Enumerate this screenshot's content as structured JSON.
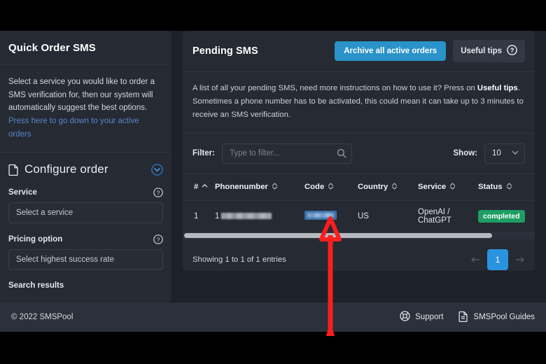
{
  "sidebar": {
    "title": "Quick Order SMS",
    "intro_text": "Select a service you would like to order a SMS verification for, then our system will automatically suggest the best options.",
    "intro_link": "Press here to go down to your active orders",
    "configure": {
      "title": "Configure order",
      "collapse_icon": "chevron-down-circle-icon",
      "doc_icon": "document-icon",
      "service_label": "Service",
      "service_help_icon": "question-circle-icon",
      "service_value": "Select a service",
      "pricing_label": "Pricing option",
      "pricing_help_icon": "question-circle-icon",
      "pricing_value": "Select highest success rate",
      "search_results_label": "Search results"
    }
  },
  "main": {
    "title": "Pending SMS",
    "archive_button": "Archive all active orders",
    "tips_button": "Useful tips",
    "tips_icon": "question-circle-icon",
    "description_part1": "A list of all your pending SMS, need more instructions on how to use it? Press on ",
    "description_bold": "Useful tips",
    "description_part2": ". Sometimes a phone number has to be activated, this could mean it can take up to 3 minutes to receive an SMS verification.",
    "filter": {
      "label": "Filter:",
      "placeholder": "Type to filter...",
      "value": "",
      "search_icon": "search-icon"
    },
    "show": {
      "label": "Show:",
      "value": "10",
      "chevron_icon": "chevron-down-icon"
    },
    "table": {
      "columns": [
        {
          "label": "#",
          "sort_icon": "sort-asc-icon"
        },
        {
          "label": "Phonenumber",
          "sort_icon": "sort-both-icon"
        },
        {
          "label": "Code",
          "sort_icon": "sort-both-icon"
        },
        {
          "label": "Country",
          "sort_icon": "sort-both-icon"
        },
        {
          "label": "Service",
          "sort_icon": "sort-both-icon"
        },
        {
          "label": "Status",
          "sort_icon": "sort-both-icon"
        }
      ],
      "rows": [
        {
          "index": "1",
          "phone_prefix": "1",
          "phone_redacted": true,
          "code_redacted": true,
          "code_selected": true,
          "country": "US",
          "service": "OpenAI / ChatGPT",
          "status": "completed",
          "status_color": "#1e9e63"
        }
      ],
      "scrollbar": "horizontal-scrollbar"
    },
    "footer": {
      "showing_text": "Showing 1 to 1 of 1 entries",
      "prev_icon": "arrow-left-icon",
      "next_icon": "arrow-right-icon",
      "current_page": "1"
    }
  },
  "page_footer": {
    "copyright": "© 2022 SMSPool",
    "support_label": "Support",
    "support_icon": "lifering-icon",
    "guides_label": "SMSPool Guides",
    "guides_icon": "document-icon"
  },
  "annotation": {
    "arrow_icon": "red-arrow-up",
    "color": "#fa1e1e"
  },
  "colors": {
    "accent_blue": "#2a93c9",
    "page_bg": "#1d2129",
    "card_bg": "#252a33",
    "success_green": "#1e9e63",
    "link_blue": "#5b86c9"
  }
}
